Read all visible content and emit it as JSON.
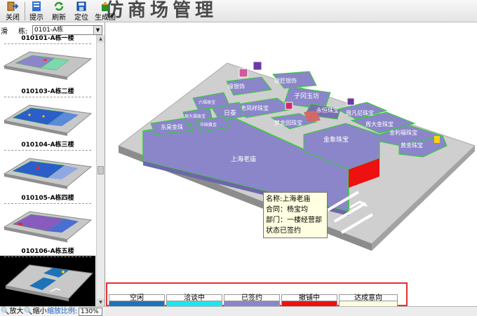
{
  "toolbar": {
    "banner": "仿商场管理",
    "buttons": [
      {
        "label": "关闭",
        "icon": "close-icon"
      },
      {
        "label": "提示",
        "icon": "hint-icon"
      },
      {
        "label": "刷新",
        "icon": "refresh-icon"
      },
      {
        "label": "定位",
        "icon": "locate-icon"
      },
      {
        "label": "生成图",
        "icon": "generate-icon"
      }
    ]
  },
  "sidebar": {
    "cut_text": "滑",
    "building_label": "栋:",
    "building_value": "0101-A栋",
    "floors": [
      {
        "label": "010101-A栋一楼"
      },
      {
        "label": "010103-A栋二楼"
      },
      {
        "label": "010104-A栋三楼"
      },
      {
        "label": "010105-A栋四楼"
      },
      {
        "label": "010106-A栋五楼"
      }
    ]
  },
  "map": {
    "shops": [
      {
        "name": "上海老庙"
      },
      {
        "name": "金象珠宝"
      },
      {
        "name": "金利福珠宝"
      },
      {
        "name": "黄金珠宝"
      },
      {
        "name": "周大金珠宝"
      },
      {
        "name": "梦金园珠宝"
      },
      {
        "name": "老凤祥珠宝"
      },
      {
        "name": "子冈玉坊"
      },
      {
        "name": "银匠银饰"
      },
      {
        "name": "缘银饰"
      },
      {
        "name": "日泰"
      },
      {
        "name": "东昊金珠"
      },
      {
        "name": "六福珠宝"
      },
      {
        "name": "周大福珠宝"
      },
      {
        "name": "周凡尼珠宝"
      },
      {
        "name": "永恒珠宝"
      },
      {
        "name": "中国黄金"
      }
    ]
  },
  "tooltip": {
    "line1": "名称:上海老庙",
    "line2": "合同：杨宝均",
    "line3": "部门：一楼经营部",
    "line4": "状态已签约"
  },
  "legend": {
    "items": [
      {
        "label": "空闲",
        "color": "#1e73b8"
      },
      {
        "label": "洽谈中",
        "color": "#1ee6ee"
      },
      {
        "label": "已签约",
        "color": "#8b86c9"
      },
      {
        "label": "撤铺中",
        "color": "#ee1111"
      },
      {
        "label": "达成意向",
        "color": "#fffde0"
      }
    ]
  },
  "status": {
    "zoom_in": "放大",
    "zoom_out": "缩小",
    "zoom_label": "缩放比例:",
    "zoom_value": "130%"
  }
}
